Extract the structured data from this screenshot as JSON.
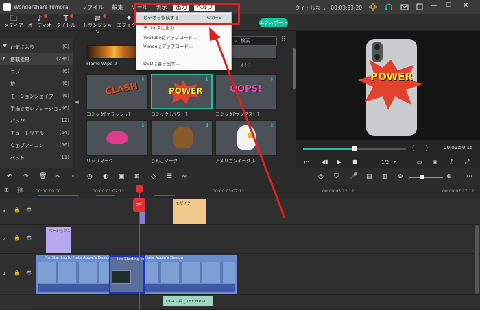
{
  "app": {
    "title": "Wondershare Filmora",
    "project_title": "タイトルなし : 00:03:33:20"
  },
  "menubar": [
    "ファイル",
    "編集",
    "ツール",
    "表示",
    "出力",
    "ヘルプ"
  ],
  "toolbar": {
    "items": [
      "メディア",
      "オーディオ",
      "タイトル",
      "トランジション",
      "エフェクト"
    ],
    "export_label": "エクスポート"
  },
  "dropdown": {
    "items": [
      {
        "label": "ビデオを作成する",
        "shortcut": "Ctrl+E"
      },
      {
        "label": "デバイスに出力..."
      },
      {
        "label": "YouTubeにアップロード..."
      },
      {
        "label": "Vimeoにアップロード..."
      },
      {
        "label": "DVDに書き出す..."
      }
    ]
  },
  "sidebar": {
    "items": [
      {
        "label": "お気に入り",
        "count": "(0)"
      },
      {
        "label": "搭載素材",
        "count": "(286)"
      },
      {
        "label": "ラブ",
        "count": "(6)"
      },
      {
        "label": "旅",
        "count": "(6)"
      },
      {
        "label": "モーションシェイプ",
        "count": "(6)"
      },
      {
        "label": "手描きセレブレーション",
        "count": "(6)"
      },
      {
        "label": "バッジ",
        "count": "(12)"
      },
      {
        "label": "チュートリアル",
        "count": "(64)"
      },
      {
        "label": "ウェブアイコン",
        "count": "(56)"
      },
      {
        "label": "ペット",
        "count": "(11)"
      }
    ]
  },
  "search": {
    "placeholder": "検索"
  },
  "grid": {
    "row1": [
      "Flame Wipe 2",
      "",
      "オ！)"
    ],
    "row2": [
      "コミック[クラッシュ]",
      "コミック [パワー]",
      "コミック[ウップス！]"
    ],
    "row3": [
      "リップマーク",
      "うんこマーク",
      "アメリカンイーグル"
    ],
    "comic_words": [
      "CLASH",
      "POWER",
      "OOPS!"
    ]
  },
  "preview": {
    "comic_word": "POWER",
    "timecode": "00:01:50:15",
    "zoom": "1/2",
    "progress": 0.5
  },
  "ruler": [
    "00:00:00:00",
    "00:00:01:02:12",
    "00:00:03:07:12",
    "00:00:05:12:12",
    "00:00:07:17:12"
  ],
  "tracks": {
    "track1_label": "3",
    "track1_clip": "モザイク",
    "track2_label": "2",
    "track2_clip": "ベーシック1",
    "track3_label": "1",
    "video_clip": "I'm Starting to Hate Apple's Design ... I'm Starting to Hate Apple's Design",
    "video_clip2": "I'm Starting to",
    "audio_clip": "LIGA - 兵 _ THE FIRST"
  },
  "colors": {
    "accent": "#1dbf9f",
    "highlight": "#e02020",
    "playhead": "#e03030"
  }
}
